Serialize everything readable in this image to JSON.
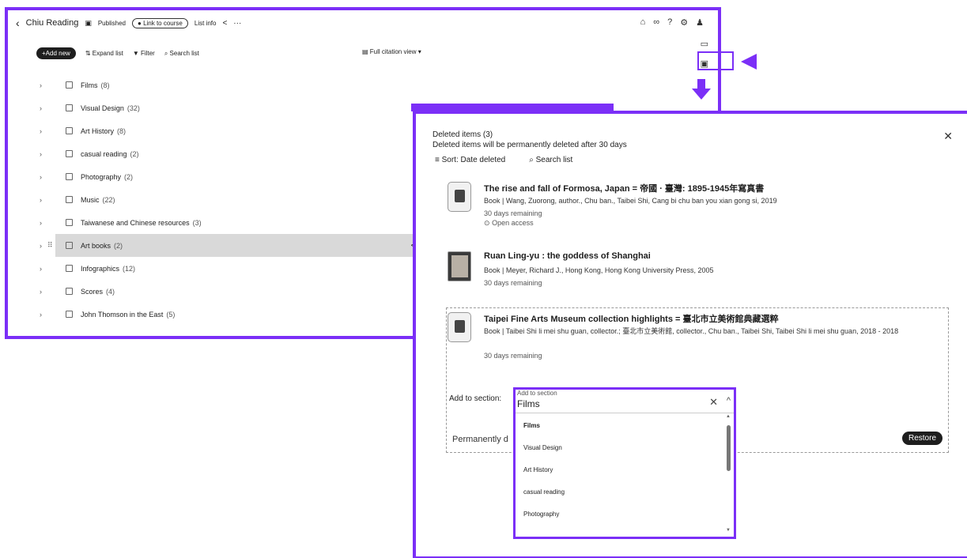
{
  "colors": {
    "accent": "#7b2ff7",
    "dark": "#1e1e1e"
  },
  "list": {
    "title": "Chiu Reading",
    "status": "Published",
    "link_to_course": "Link to course",
    "list_info": "List info",
    "toolbar": {
      "add_new": "+Add new",
      "expand_list": "Expand list",
      "filter": "Filter",
      "search_list": "Search list",
      "citation_view": "Full citation view"
    },
    "sections": [
      {
        "label": "Films",
        "count": "(8)"
      },
      {
        "label": "Visual Design",
        "count": "(32)"
      },
      {
        "label": "Art History",
        "count": "(8)"
      },
      {
        "label": "casual reading",
        "count": "(2)"
      },
      {
        "label": "Photography",
        "count": "(2)"
      },
      {
        "label": "Music",
        "count": "(22)"
      },
      {
        "label": "Taiwanese and Chinese resources",
        "count": "(3)"
      },
      {
        "label": "Art books",
        "count": "(2)"
      },
      {
        "label": "Infographics",
        "count": "(12)"
      },
      {
        "label": "Scores",
        "count": "(4)"
      },
      {
        "label": "John Thomson in the East",
        "count": "(5)"
      }
    ]
  },
  "deleted": {
    "heading": "Deleted items (3)",
    "subheading": "Deleted items will be permanently deleted after 30 days",
    "sort": "Sort: Date deleted",
    "search": "Search list",
    "items": [
      {
        "title": "The rise and fall of Formosa, Japan = 帝國 · 臺灣: 1895-1945年寫真書",
        "meta": "Book | Wang, Zuorong, author., Chu ban., Taibei Shi, Cang bi chu ban you xian gong si, 2019",
        "remaining": "30 days remaining",
        "access": "Open access"
      },
      {
        "title": "Ruan Ling-yu : the goddess of Shanghai",
        "meta": "Book | Meyer, Richard J., Hong Kong, Hong Kong University Press, 2005",
        "remaining": "30 days remaining"
      },
      {
        "title": "Taipei Fine Arts Museum collection highlights = 臺北市立美術館典藏選粹",
        "meta": "Book | Taibei Shi li mei shu guan, collector.; 臺北市立美術館, collector., Chu ban., Taibei Shi, Taibei Shi li mei shu guan, 2018 - 2018",
        "remaining": "30 days remaining"
      }
    ],
    "add_to_section_label": "Add to section:",
    "permanently_delete": "Permanently d",
    "restore": "Restore"
  },
  "dropdown": {
    "label": "Add to section",
    "value": "Films",
    "options": [
      "Films",
      "Visual Design",
      "Art History",
      "casual reading",
      "Photography"
    ]
  }
}
